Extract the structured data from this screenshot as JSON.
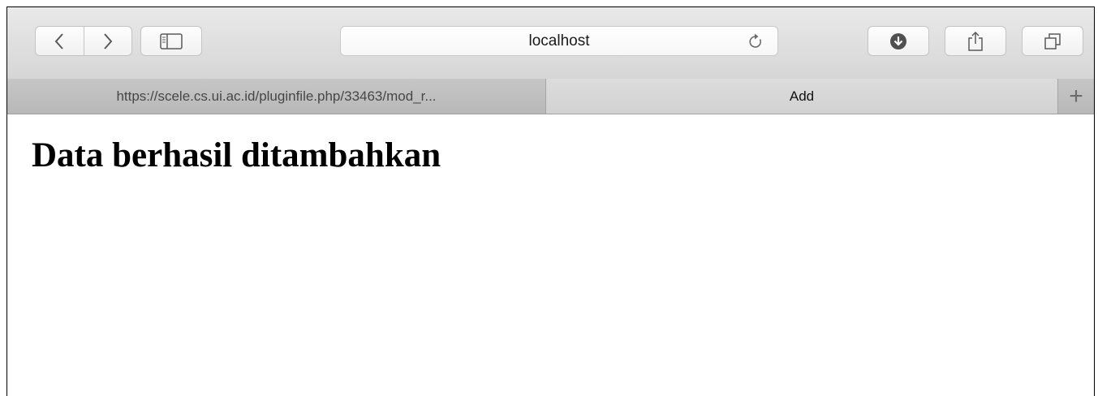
{
  "browser": {
    "address_bar": {
      "text": "localhost"
    },
    "tabs": [
      {
        "label": "https://scele.cs.ui.ac.id/pluginfile.php/33463/mod_r...",
        "active": false
      },
      {
        "label": "Add",
        "active": true
      }
    ],
    "new_tab_label": "+"
  },
  "page": {
    "heading": "Data berhasil ditambahkan"
  },
  "icons": {
    "back": "chevron-left-icon",
    "forward": "chevron-right-icon",
    "sidebar": "sidebar-icon",
    "reload": "reload-icon",
    "downloads": "download-icon",
    "share": "share-icon",
    "tabs": "tab-overview-icon"
  }
}
